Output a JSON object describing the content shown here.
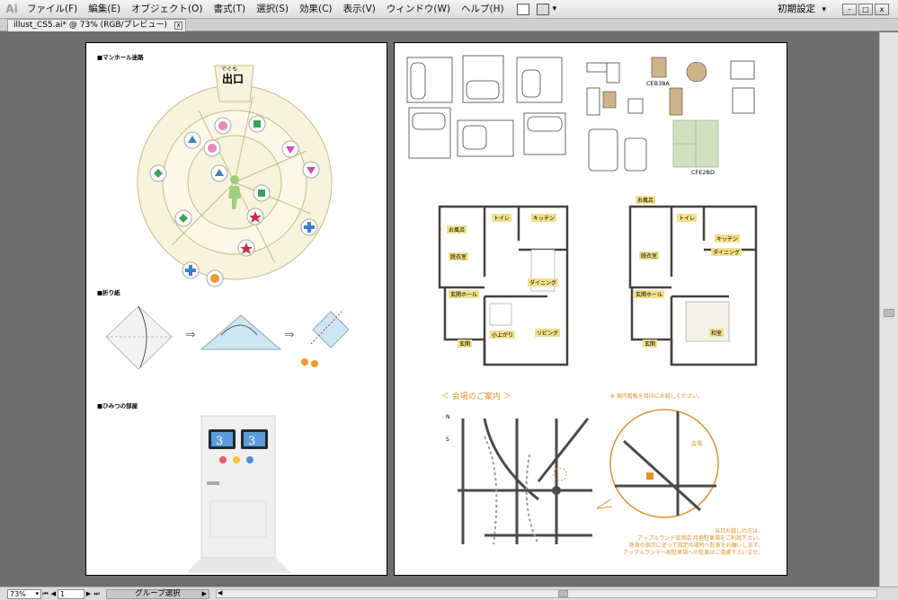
{
  "app": {
    "logo": "Ai",
    "workspace": "初期設定",
    "workspace_caret": "▾"
  },
  "menu": {
    "items": [
      "ファイル(F)",
      "編集(E)",
      "オブジェクト(O)",
      "書式(T)",
      "選択(S)",
      "効果(C)",
      "表示(V)",
      "ウィンドウ(W)",
      "ヘルプ(H)"
    ]
  },
  "window_controls": {
    "minimize": "–",
    "restore": "□",
    "close": "x"
  },
  "tab": {
    "title": "illust_CS5.ai* @ 73% (RGB/プレビュー)",
    "close": "x"
  },
  "left_artboard": {
    "manhole": {
      "heading": "■マンホール迷路",
      "exit_ruby": "でぐち",
      "exit_label": "出口"
    },
    "origami": {
      "heading": "■折り紙",
      "arrow": "⇒"
    },
    "secret_room": {
      "heading": "■ひみつの部屋",
      "digit_left": "3",
      "digit_right": "3"
    }
  },
  "right_artboard": {
    "furniture": {
      "label_table": "CEB38A",
      "label_tatami": "CFE2BD"
    },
    "plan_a": {
      "rooms": [
        "お風呂",
        "トイレ",
        "キッチン",
        "脱衣室",
        "玄関ホール",
        "ダイニング",
        "玄関",
        "小上がり",
        "リビング"
      ]
    },
    "plan_b": {
      "rooms": [
        "お風呂",
        "トイレ",
        "キッチン",
        "ダイニング",
        "脱衣室",
        "玄関ホール",
        "玄関",
        "和室"
      ]
    },
    "map": {
      "title": "＜ 会場のご案内 ＞",
      "note": "※ 案内看板を目印にお越しください。",
      "compass_n": "N",
      "compass_s": "S",
      "legend_venue": "会場",
      "footer": [
        "当日お越しの方は、",
        "アップルランド宮渕店 月極駐車場をご利用下さい。",
        "係員の指示に従って指定の場所へ駐車をお願いします。",
        "アップルランド一般駐車場への駐車はご遠慮下さいませ。"
      ]
    }
  },
  "status": {
    "zoom": "73%",
    "page": "1",
    "tool": "グループ選択",
    "nav_first": "⏮",
    "nav_prev": "◀",
    "nav_next": "▶",
    "nav_last": "⏭",
    "dropdown": "▾",
    "arrow_right": "▶",
    "arrow_left": "◀"
  },
  "colors": {
    "manhole_fill": "#f7f3dc",
    "manhole_stroke": "#c9b98a",
    "floor_wall": "#4a4038",
    "room_tag": "#f3e08c",
    "map_orange": "#e0922b",
    "tatami": "#cfe2bd",
    "table_wood": "#ceb38a",
    "origami_blue": "#cde6f2"
  }
}
